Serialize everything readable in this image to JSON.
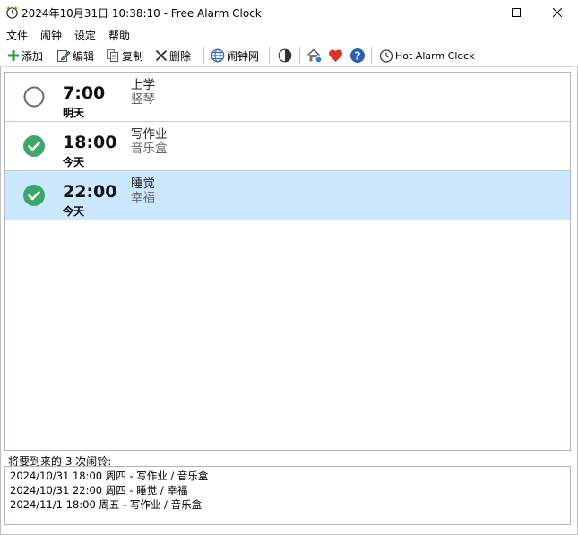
{
  "window": {
    "title": "2024年10月31日 10:38:10 - Free Alarm Clock",
    "app_icon": "alarm-clock-icon",
    "controls": [
      "minimize-icon",
      "maximize-icon",
      "close-icon"
    ]
  },
  "menu": {
    "items": [
      {
        "label": "文件"
      },
      {
        "label": "闹钟"
      },
      {
        "label": "设定"
      },
      {
        "label": "帮助"
      }
    ]
  },
  "toolbar": {
    "add": {
      "label": "添加",
      "icon": "plus-icon"
    },
    "edit": {
      "label": "编辑",
      "icon": "edit-icon"
    },
    "copy": {
      "label": "复制",
      "icon": "copy-icon"
    },
    "delete": {
      "label": "删除",
      "icon": "delete-icon"
    },
    "web": {
      "label": "闹钟网",
      "icon": "globe-icon"
    },
    "theme": {
      "icon": "contrast-icon"
    },
    "home": {
      "icon": "home-icon"
    },
    "donate": {
      "icon": "heart-icon"
    },
    "help": {
      "icon": "help-icon"
    },
    "hot": {
      "label": "Hot Alarm Clock",
      "icon": "clock-icon"
    }
  },
  "alarms": [
    {
      "time": "7:00",
      "day": "明天",
      "description": "上学",
      "sound": "竖琴",
      "enabled": false,
      "selected": false
    },
    {
      "time": "18:00",
      "day": "今天",
      "description": "写作业",
      "sound": "音乐盒",
      "enabled": true,
      "selected": false
    },
    {
      "time": "22:00",
      "day": "今天",
      "description": "睡觉",
      "sound": "幸福",
      "enabled": true,
      "selected": true
    }
  ],
  "upcoming": {
    "label": "将要到来的 3 次闹铃:",
    "items": [
      "2024/10/31 18:00 周四 - 写作业 / 音乐盒",
      "2024/10/31 22:00 周四 - 睡觉 / 幸福",
      "2024/11/1 18:00 周五 - 写作业 / 音乐盒"
    ]
  },
  "colors": {
    "enabled_check": "#3fa66b",
    "selected_row": "#cce8ff",
    "heart": "#d9342b",
    "help": "#2b5fb3",
    "add": "#2a9d3a"
  }
}
